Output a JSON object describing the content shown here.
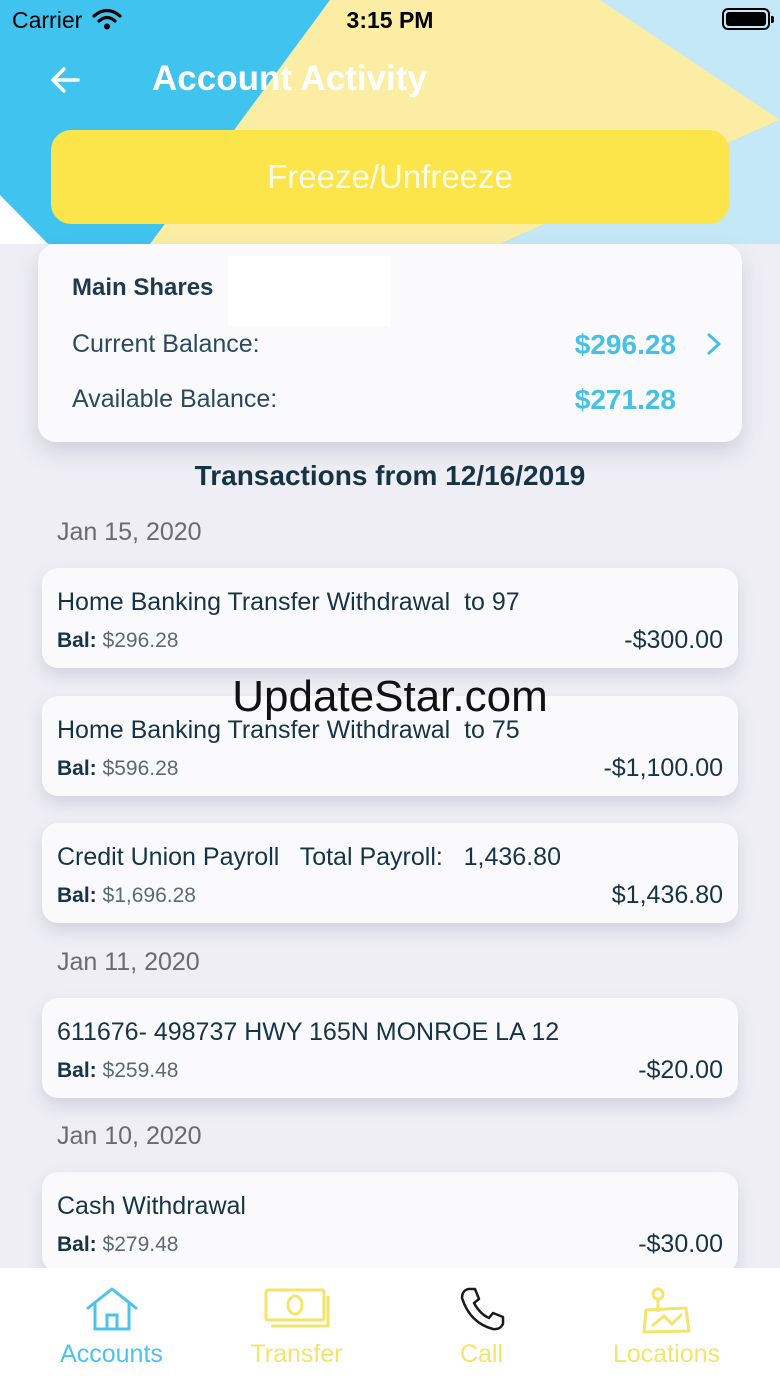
{
  "status_bar": {
    "carrier": "Carrier",
    "time": "3:15 PM"
  },
  "header": {
    "title": "Account Activity",
    "freeze_label": "Freeze/Unfreeze"
  },
  "account": {
    "name": "Main Shares",
    "current_label": "Current Balance:",
    "current_value": "$296.28",
    "available_label": "Available Balance:",
    "available_value": "$271.28"
  },
  "transactions_heading": "Transactions from 12/16/2019",
  "dates": [
    "Jan 15, 2020",
    "Jan 11, 2020",
    "Jan 10, 2020"
  ],
  "transactions": [
    {
      "desc": "Home Banking Transfer Withdrawal  to 97",
      "bal_label": "Bal:",
      "bal": "$296.28",
      "amount": "-$300.00"
    },
    {
      "desc": "Home Banking Transfer Withdrawal  to 75",
      "bal_label": "Bal:",
      "bal": "$596.28",
      "amount": "-$1,100.00"
    },
    {
      "desc": "Credit Union Payroll   Total Payroll:   1,436.80",
      "bal_label": "Bal:",
      "bal": "$1,696.28",
      "amount": "$1,436.80"
    },
    {
      "desc": "611676- 498737 HWY 165N MONROE LA 12",
      "bal_label": "Bal:",
      "bal": "$259.48",
      "amount": "-$20.00"
    },
    {
      "desc": "Cash Withdrawal",
      "bal_label": "Bal:",
      "bal": "$279.48",
      "amount": "-$30.00"
    }
  ],
  "watermark": "UpdateStar.com",
  "tabs": [
    {
      "label": "Accounts",
      "icon": "home-icon",
      "color": "#4cc3ec"
    },
    {
      "label": "Transfer",
      "icon": "cash-icon",
      "color": "#f3e46a"
    },
    {
      "label": "Call",
      "icon": "phone-icon",
      "color": "#f3e46a"
    },
    {
      "label": "Locations",
      "icon": "map-pin-icon",
      "color": "#f3e46a"
    }
  ],
  "colors": {
    "header_blue": "#40c3ef",
    "accent_yellow": "#fbe54a",
    "balance_blue": "#47c0e8"
  }
}
